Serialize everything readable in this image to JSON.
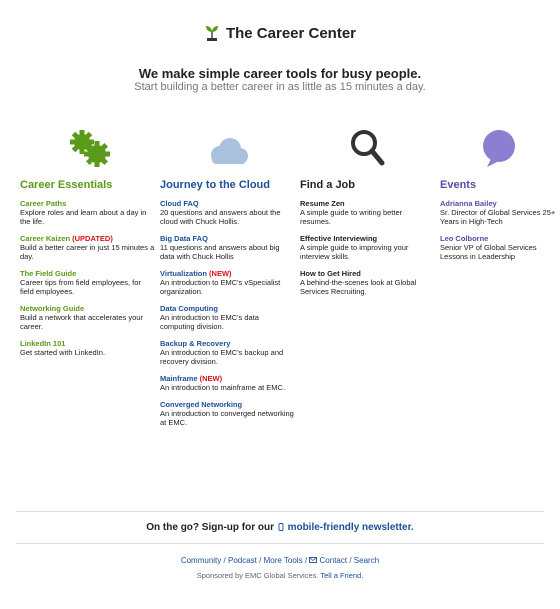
{
  "header": {
    "brand": "The Career Center",
    "tagline": "We make simple career tools for busy people.",
    "subline": "Start building a better career in as little as 15 minutes a day."
  },
  "columns": [
    {
      "title": "Career Essentials",
      "icon": "gears-icon",
      "items": [
        {
          "title": "Career Paths",
          "tag": "",
          "desc": "Explore roles and learn about a day in the life."
        },
        {
          "title": "Career Kaizen",
          "tag": "(UPDATED)",
          "desc": "Build a better career in just 15 minutes a day."
        },
        {
          "title": "The Field Guide",
          "tag": "",
          "desc": "Career tips from field employees, for field employees."
        },
        {
          "title": "Networking Guide",
          "tag": "",
          "desc": "Build a network that accelerates your career."
        },
        {
          "title": "LinkedIn 101",
          "tag": "",
          "desc": "Get started with LinkedIn."
        }
      ]
    },
    {
      "title": "Journey to the Cloud",
      "icon": "cloud-icon",
      "items": [
        {
          "title": "Cloud FAQ",
          "tag": "",
          "desc": "20 questions and answers about the cloud with Chuck Hollis."
        },
        {
          "title": "Big Data FAQ",
          "tag": "",
          "desc": "11 questions and answers about big data with Chuck Hollis"
        },
        {
          "title": "Virtualization",
          "tag": "(NEW)",
          "desc": "An introduction to EMC's vSpecialist organization."
        },
        {
          "title": "Data Computing",
          "tag": "",
          "desc": "An introduction to EMC's data computing division."
        },
        {
          "title": "Backup & Recovery",
          "tag": "",
          "desc": "An introduction to EMC's backup and recovery division."
        },
        {
          "title": "Mainframe",
          "tag": "(NEW)",
          "desc": "An introduction to mainframe at EMC."
        },
        {
          "title": "Converged Networking",
          "tag": "",
          "desc": "An introduction to converged networking at EMC."
        }
      ]
    },
    {
      "title": "Find a Job",
      "icon": "magnifier-icon",
      "items": [
        {
          "title": "Resume Zen",
          "tag": "",
          "desc": "A simple guide to writing better resumes."
        },
        {
          "title": "Effective Interviewing",
          "tag": "",
          "desc": "A simple guide to improving your interview skills."
        },
        {
          "title": "How to Get Hired",
          "tag": "",
          "desc": "A behind-the-scenes look at Global Services Recruiting."
        }
      ]
    },
    {
      "title": "Events",
      "icon": "speech-bubble-icon",
      "items": [
        {
          "title": "Adrianna Bailey",
          "tag": "",
          "desc": "Sr. Director of Global Services 25+ Years in High-Tech"
        },
        {
          "title": "Leo Colborne",
          "tag": "",
          "desc": "Senior VP of Global Services Lessons in Leadership"
        }
      ]
    }
  ],
  "cta": {
    "text": "On the go? Sign-up for our",
    "link": "mobile-friendly newsletter."
  },
  "footer": {
    "links": [
      "Community",
      "Podcast",
      "More Tools",
      "Contact",
      "Search"
    ],
    "sponsor": "Sponsored by EMC Global Services.",
    "tell_friend": "Tell a Friend."
  },
  "colors": {
    "green": "#5a9a1a",
    "blue": "#1f4f97",
    "purple": "#5b4aa5",
    "red": "#d4121a",
    "cloud": "#a9c1dc",
    "bubble": "#8a7fd0"
  }
}
